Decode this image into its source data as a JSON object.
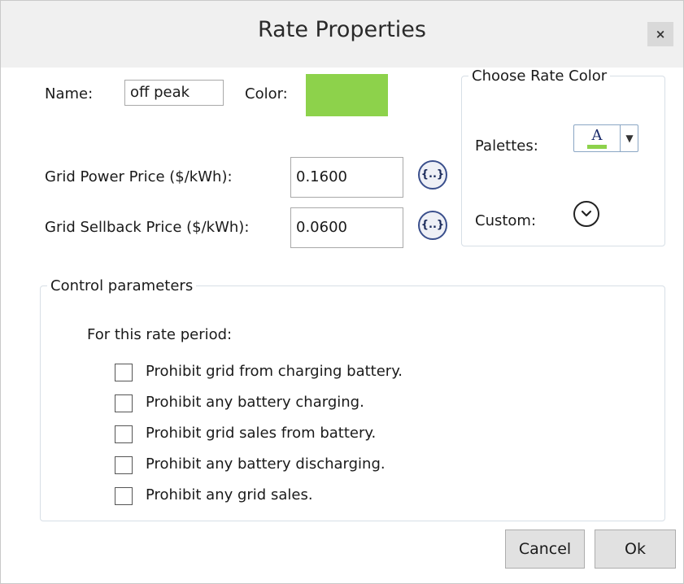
{
  "window": {
    "title": "Rate Properties",
    "close_glyph": "×",
    "close_icon": "close-icon"
  },
  "rate": {
    "name_label": "Name:",
    "name_value": "off peak",
    "color_label": "Color:",
    "color_value": "#8dd24b",
    "grid_power_label": "Grid Power Price ($/kWh):",
    "grid_power_value": "0.1600",
    "grid_sellback_label": "Grid Sellback Price ($/kWh):",
    "grid_sellback_value": "0.0600",
    "expression_glyph": "{..}",
    "expression_icon": "expression-icon"
  },
  "choose_color": {
    "legend": "Choose Rate Color",
    "palettes_label": "Palettes:",
    "palette_glyph": "A",
    "palette_icon": "font-color-icon",
    "dropdown_glyph": "▼",
    "custom_label": "Custom:",
    "custom_icon": "chevron-down-circle-icon"
  },
  "control": {
    "legend": "Control parameters",
    "subtitle": "For this rate period:",
    "options": [
      {
        "label": "Prohibit grid from charging battery.",
        "checked": false
      },
      {
        "label": "Prohibit any battery charging.",
        "checked": false
      },
      {
        "label": "Prohibit grid sales from battery.",
        "checked": false
      },
      {
        "label": "Prohibit any battery discharging.",
        "checked": false
      },
      {
        "label": "Prohibit any grid sales.",
        "checked": false
      }
    ]
  },
  "buttons": {
    "cancel": "Cancel",
    "ok": "Ok"
  }
}
